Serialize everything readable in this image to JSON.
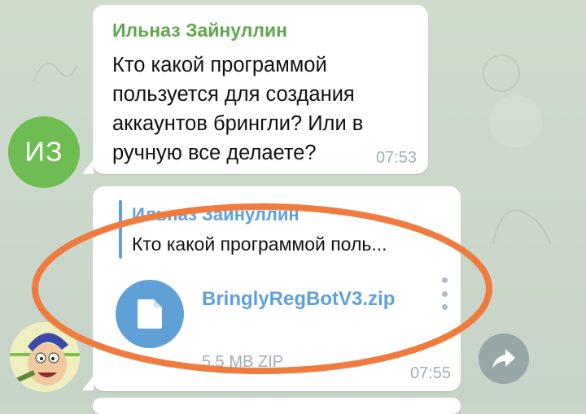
{
  "messages": [
    {
      "sender": "Ильназ Зайнуллин",
      "avatar_initials": "ИЗ",
      "text": "Кто какой программой пользуется для создания аккаунтов брингли? Или в ручную все делаете?",
      "time": "07:53"
    }
  ],
  "reply_message": {
    "quoted_sender": "Ильназ Зайнуллин",
    "quoted_text": "Кто какой программой поль...",
    "file": {
      "name": "BringlyRegBotV3.zip",
      "size_type": "5,5 MB ZIP",
      "icon": "document-icon"
    },
    "time": "07:55"
  },
  "icons": {
    "share": "share-arrow-icon",
    "menu": "more-vertical-icon"
  },
  "colors": {
    "sender_name": "#5ea84b",
    "accent_blue": "#5fa1d6",
    "avatar_bg": "#6fbd52",
    "time_gray": "#a3adb5",
    "highlight": "#f07b3f"
  }
}
